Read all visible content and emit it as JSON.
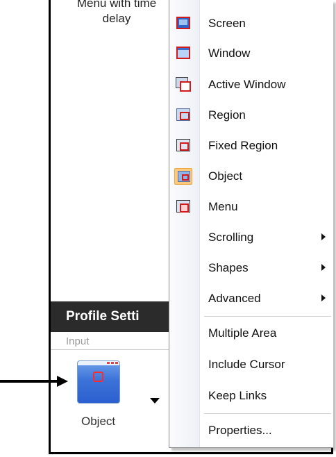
{
  "background_window": {
    "menu_item_tail": "Menu with time delay",
    "profile_bar_title": "Profile Setti",
    "input_label": "Input",
    "object_button_label": "Object"
  },
  "context_menu": {
    "items": [
      {
        "label": "Screen",
        "icon": "screen-capture-icon"
      },
      {
        "label": "Window",
        "icon": "window-capture-icon"
      },
      {
        "label": "Active Window",
        "icon": "active-window-icon"
      },
      {
        "label": "Region",
        "icon": "region-icon"
      },
      {
        "label": "Fixed Region",
        "icon": "fixed-region-icon"
      },
      {
        "label": "Object",
        "icon": "object-icon",
        "selected": true
      },
      {
        "label": "Menu",
        "icon": "menu-capture-icon"
      },
      {
        "label": "Scrolling",
        "submenu": true
      },
      {
        "label": "Shapes",
        "submenu": true
      },
      {
        "label": "Advanced",
        "submenu": true
      },
      {
        "label": "Multiple Area"
      },
      {
        "label": "Include Cursor"
      },
      {
        "label": "Keep Links"
      },
      {
        "label": "Properties..."
      }
    ]
  },
  "colors": {
    "highlight_icon_bg": "#fcc97e",
    "profile_bar_bg": "#2b2b2b",
    "accent_red": "#d21a1a"
  }
}
